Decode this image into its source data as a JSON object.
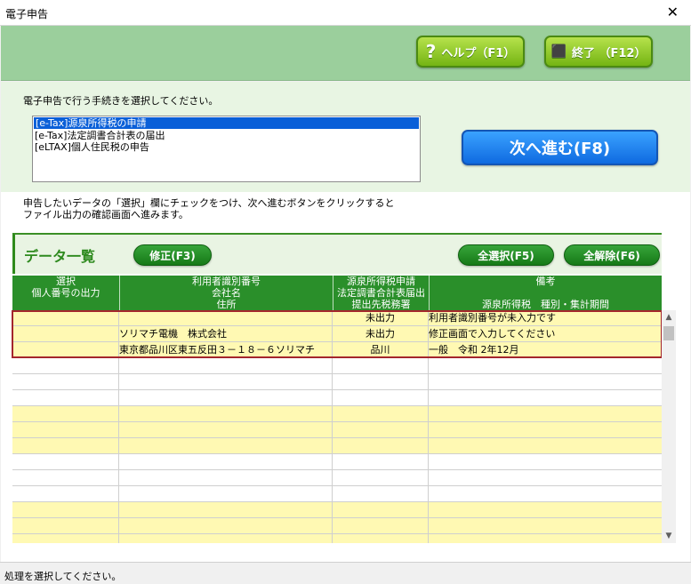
{
  "window": {
    "title": "電子申告",
    "close_glyph": "✕"
  },
  "toolbar": {
    "help": {
      "icon": "question-icon",
      "glyph": "?",
      "label": "ヘルプ（F1）"
    },
    "exit": {
      "icon": "exit-icon",
      "glyph": "⬛",
      "label": "終了 （F12）"
    }
  },
  "procedure": {
    "prompt": "電子申告で行う手続きを選択してください。",
    "items": [
      {
        "label": "[e-Tax]源泉所得税の申請",
        "selected": true
      },
      {
        "label": "[e-Tax]法定調書合計表の届出",
        "selected": false
      },
      {
        "label": "[eLTAX]個人住民税の申告",
        "selected": false
      }
    ],
    "next_label": "次へ進む(F8)"
  },
  "instructions": {
    "line1": "申告したいデータの「選択」欄にチェックをつけ、次へ進むボタンをクリックすると",
    "line2": "ファイル出力の確認画面へ進みます。"
  },
  "data_list": {
    "title": "データ一覧",
    "edit_label": "修正(F3)",
    "select_all_label": "全選択(F5)",
    "deselect_all_label": "全解除(F6)",
    "headers": {
      "row1": [
        "選択",
        "利用者識別番号",
        "源泉所得税申請",
        "備考"
      ],
      "row2": [
        "個人番号の出力",
        "会社名",
        "法定調書合計表届出",
        ""
      ],
      "row3": [
        "",
        "住所",
        "提出先税務署",
        "源泉所得税　種別・集計期間"
      ]
    },
    "record": {
      "row1": [
        "",
        "",
        "未出力",
        "利用者識別番号が未入力です"
      ],
      "row2": [
        "",
        "ソリマチ電機　株式会社",
        "未出力",
        "修正画面で入力してください"
      ],
      "row3": [
        "",
        "東京都品川区東五反田３－１８－６ソリマチ",
        "品川",
        "一般　令和 2年12月"
      ]
    }
  },
  "scrollbar": {
    "up_glyph": "▲",
    "down_glyph": "▼"
  },
  "status": {
    "text": "処理を選択してください。"
  },
  "colors": {
    "band": "#9bcf9c",
    "header_green": "#2a8f2a",
    "row_yellow": "#fff9b3",
    "selection_border": "#a4262c"
  }
}
